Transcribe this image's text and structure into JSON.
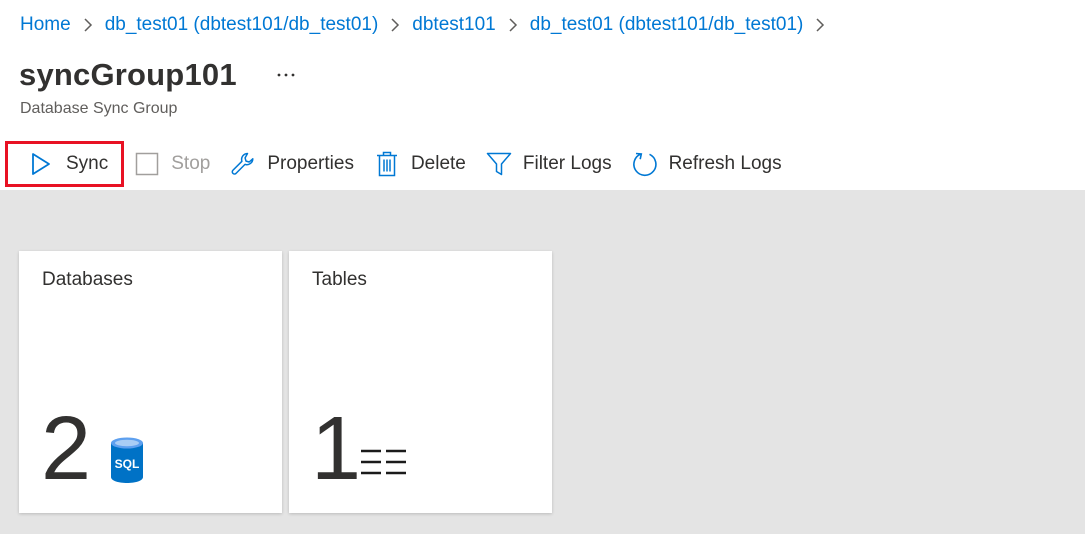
{
  "breadcrumb": {
    "items": [
      {
        "label": "Home"
      },
      {
        "label": "db_test01 (dbtest101/db_test01)"
      },
      {
        "label": "dbtest101"
      },
      {
        "label": "db_test01 (dbtest101/db_test01)"
      }
    ]
  },
  "header": {
    "title": "syncGroup101",
    "more": "···",
    "subtitle": "Database Sync Group"
  },
  "toolbar": {
    "sync_label": "Sync",
    "stop_label": "Stop",
    "properties_label": "Properties",
    "delete_label": "Delete",
    "filter_logs_label": "Filter Logs",
    "refresh_logs_label": "Refresh Logs"
  },
  "tiles": {
    "databases": {
      "title": "Databases",
      "count": "2",
      "icon": "sql-database-icon",
      "icon_text": "SQL"
    },
    "tables": {
      "title": "Tables",
      "count": "1",
      "icon": "table-list-icon"
    }
  },
  "colors": {
    "accent": "#0078d4",
    "highlight": "#e81123",
    "content_bg": "#e4e4e4"
  }
}
